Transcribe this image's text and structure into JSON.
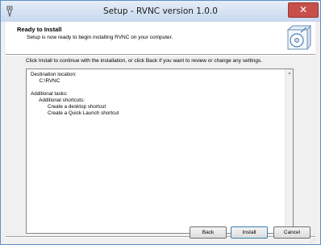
{
  "window": {
    "title": "Setup - RVNC version 1.0.0",
    "close_glyph": "✕"
  },
  "header": {
    "title": "Ready to Install",
    "subtitle": "Setup is now ready to begin installing RVNC on your computer.",
    "graphic_icon": "installer-disc-icon"
  },
  "instruction": "Click Install to continue with the installation, or click Back if you want to review or change any settings.",
  "summary": {
    "lines": [
      "Destination location:",
      "      C:\\RVNC",
      "",
      "Additional tasks:",
      "      Additional shortcuts:",
      "            Create a desktop shortcut",
      "            Create a Quick Launch shortcut"
    ]
  },
  "buttons": {
    "back": "Back",
    "install": "Install",
    "cancel": "Cancel"
  },
  "colors": {
    "titlebar": "#c7d8ee",
    "close": "#c7504b",
    "default_button_border": "#3c7fb1"
  }
}
